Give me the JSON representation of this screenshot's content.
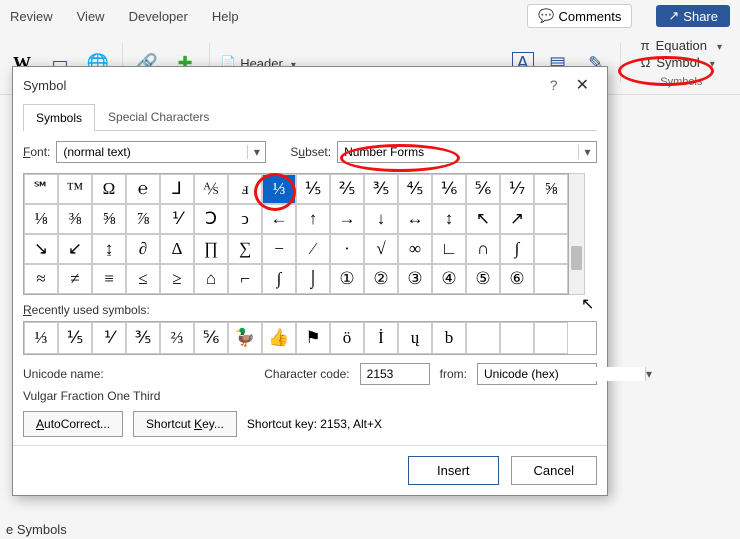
{
  "ribbon": {
    "tabs": [
      "Review",
      "View",
      "Developer",
      "Help"
    ],
    "comments": "Comments",
    "share": "Share",
    "header": "Header",
    "symbols_group": {
      "equation": "Equation",
      "symbol": "Symbol",
      "label": "Symbols"
    }
  },
  "dialog": {
    "title": "Symbol",
    "tabs": {
      "symbols": "Symbols",
      "special": "Special Characters"
    },
    "font_label": "Font:",
    "font_value": "(normal text)",
    "subset_label": "Subset:",
    "subset_value": "Number Forms",
    "grid": [
      [
        "℠",
        "™",
        "Ω",
        "℮",
        "⅃",
        "⅍",
        "ⅎ",
        "⅓",
        "⅕",
        "⅖",
        "⅗",
        "⅘",
        "⅙",
        "⅚",
        "⅐",
        "⅝"
      ],
      [
        "⅛",
        "⅜",
        "⅝",
        "⅞",
        "⅟",
        "Ↄ",
        "ↄ",
        "←",
        "↑",
        "→",
        "↓",
        "↔",
        "↕",
        "↖",
        "↗",
        ""
      ],
      [
        "↘",
        "↙",
        "↨",
        "∂",
        "Δ",
        "∏",
        "∑",
        "−",
        "∕",
        "∙",
        "√",
        "∞",
        "∟",
        "∩",
        "∫",
        ""
      ],
      [
        "≈",
        "≠",
        "≡",
        "≤",
        "≥",
        "⌂",
        "⌐",
        "∫",
        "⌡",
        "①",
        "②",
        "③",
        "④",
        "⑤",
        "⑥",
        ""
      ]
    ],
    "selected": {
      "row": 0,
      "col": 7
    },
    "recent_label": "Recently used symbols:",
    "recent": [
      "⅓",
      "⅕",
      "⅟",
      "⅗",
      "⅔",
      "⅚",
      "🦆",
      "👍",
      "⚑",
      "ö",
      "İ",
      "ų",
      "b",
      "",
      "",
      ""
    ],
    "unicode_name_label": "Unicode name:",
    "unicode_name_value": "Vulgar Fraction One Third",
    "charcode_label": "Character code:",
    "charcode_value": "2153",
    "from_label": "from:",
    "from_value": "Unicode (hex)",
    "autocorrect": "AutoCorrect...",
    "shortcutkey_btn": "Shortcut Key...",
    "shortcut_label": "Shortcut key: 2153, Alt+X",
    "insert": "Insert",
    "cancel": "Cancel"
  },
  "bottom_text": "e Symbols"
}
